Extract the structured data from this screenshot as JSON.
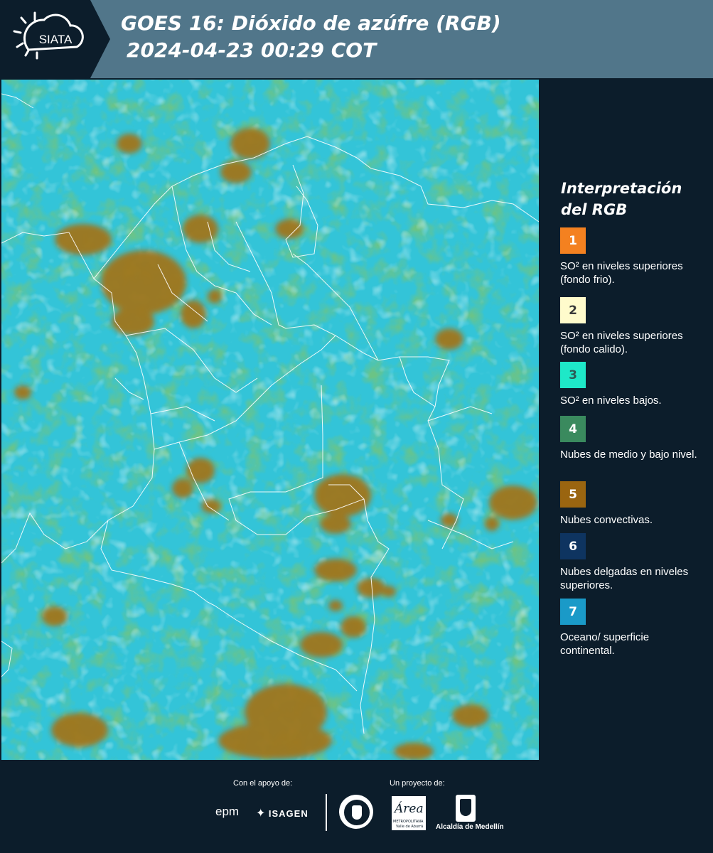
{
  "header": {
    "logo_text": "SIATA",
    "title_line1": "GOES 16: Dióxido de azúfre (RGB)",
    "title_line2": "2024-04-23 00:29 COT",
    "background_color": "#51768a",
    "logo_background_color": "#0c1d2b"
  },
  "map": {
    "description_icon": "satellite-rgb-composite-map",
    "colors": {
      "background": "#33c4d8",
      "convective": "#a0761c",
      "green": "#3a8f3d"
    }
  },
  "legend": {
    "title_line1": "Interpretación",
    "title_line2": "del RGB",
    "items": [
      {
        "number": "1",
        "color": "#f48120",
        "text_color": "#ffffff",
        "label": "SO² en niveles superiores (fondo frio)."
      },
      {
        "number": "2",
        "color": "#fffbcc",
        "text_color": "#3a3a3a",
        "label": "SO² en niveles superiores (fondo calido)."
      },
      {
        "number": "3",
        "color": "#1ee8c8",
        "text_color": "#2d5a55",
        "label": "SO² en niveles bajos."
      },
      {
        "number": "4",
        "color": "#3a8a5e",
        "text_color": "#ffffff",
        "label": "Nubes de medio y bajo nivel."
      },
      {
        "number": "5",
        "color": "#9a6510",
        "text_color": "#ffffff",
        "label": "Nubes convectivas."
      },
      {
        "number": "6",
        "color": "#0e3460",
        "text_color": "#ffffff",
        "label": "Nubes delgadas en niveles superiores."
      },
      {
        "number": "7",
        "color": "#1a9ac8",
        "text_color": "#ffffff",
        "label": "Oceano/ superficie continental."
      }
    ]
  },
  "footer": {
    "support_caption": "Con el apoyo de:",
    "project_caption": "Un proyecto de:",
    "sponsors": {
      "epm": "epm",
      "isagen": "ISAGEN",
      "area_metropolitana": "Área",
      "area_metropolitana_sub1": "METROPOLITANA",
      "area_metropolitana_sub2": "Valle de Aburrá",
      "alcaldia": "Alcaldía de Medellín"
    }
  }
}
